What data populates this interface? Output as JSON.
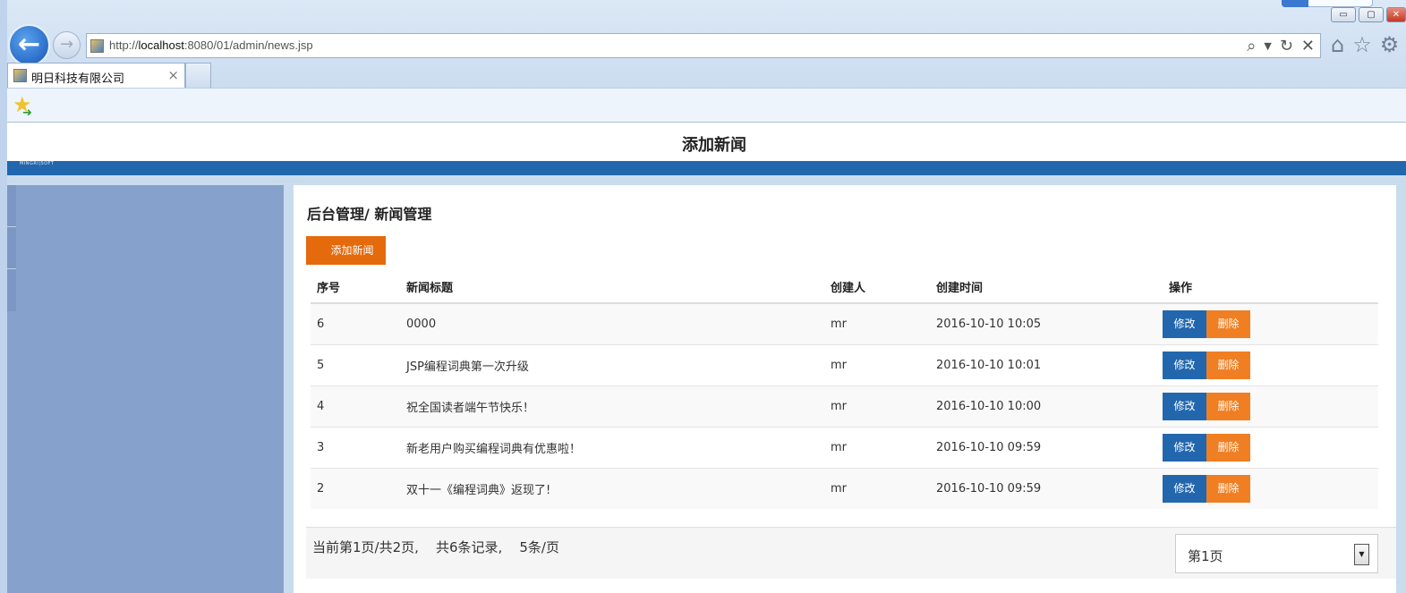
{
  "browser": {
    "url_prefix": "http://",
    "url_host": "localhost",
    "url_rest": ":8080/01/admin/news.jsp",
    "tab_title": "明日科技有限公司",
    "tab_close": "×",
    "back_glyph": "←",
    "forward_glyph": "→",
    "window_controls": {
      "minimize": "▭",
      "maximize": "▢",
      "close": "✕"
    },
    "icons": [
      "search-icon",
      "dropdown-icon",
      "refresh-icon",
      "stop-icon",
      "home-icon",
      "favorites-star-icon",
      "settings-gear-icon",
      "add-favorite-icon"
    ]
  },
  "page": {
    "header_title": "添加新闻",
    "logo_text": "MINGRI|SOFT",
    "breadcrumb": "后台管理/ 新闻管理",
    "add_button": "添加新闻"
  },
  "table": {
    "headers": {
      "id": "序号",
      "title": "新闻标题",
      "author": "创建人",
      "time": "创建时间",
      "ops": "操作"
    },
    "rows": [
      {
        "id": "6",
        "title": "0000",
        "author": "mr",
        "time": "2016-10-10 10:05"
      },
      {
        "id": "5",
        "title": "JSP编程词典第一次升级",
        "author": "mr",
        "time": "2016-10-10 10:01"
      },
      {
        "id": "4",
        "title": "祝全国读者端午节快乐！",
        "author": "mr",
        "time": "2016-10-10 10:00"
      },
      {
        "id": "3",
        "title": "新老用户购买编程词典有优惠啦！",
        "author": "mr",
        "time": "2016-10-10 09:59"
      },
      {
        "id": "2",
        "title": "双十一《编程词典》返现了!",
        "author": "mr",
        "time": "2016-10-10 09:59"
      }
    ],
    "edit_label": "修改",
    "delete_label": "删除"
  },
  "pager": {
    "info": "当前第1页/共2页,    共6条记录,    5条/页",
    "selected_page": "第1页"
  },
  "colors": {
    "header_blue": "#2267ae",
    "add_orange": "#e46a0c",
    "delete_orange": "#f07e22",
    "sidebar": "#86a2cc"
  }
}
